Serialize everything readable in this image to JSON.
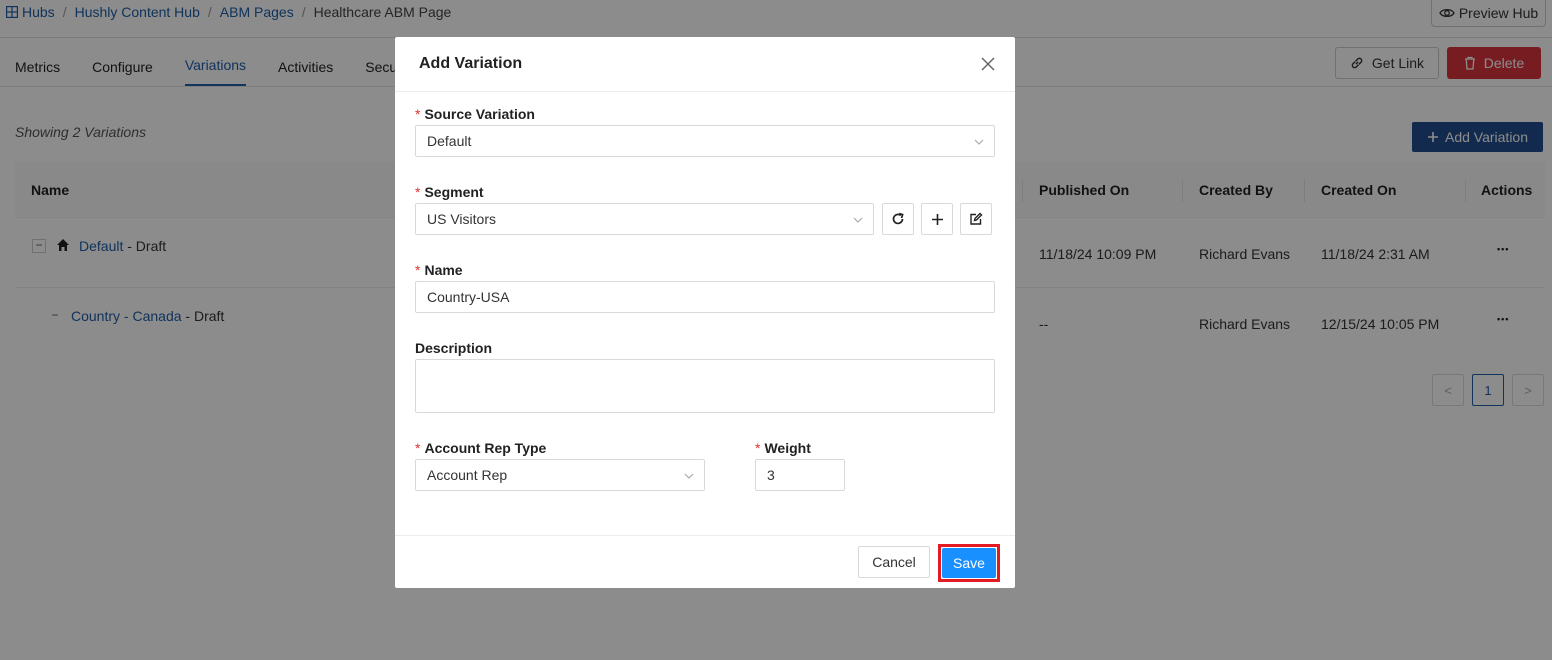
{
  "breadcrumb": {
    "items": [
      "Hubs",
      "Hushly Content Hub",
      "ABM Pages",
      "Healthcare ABM Page"
    ],
    "separator": "/"
  },
  "header": {
    "preview_label": "Preview Hub",
    "get_link_label": "Get Link",
    "delete_label": "Delete"
  },
  "tabs": [
    {
      "label": "Metrics"
    },
    {
      "label": "Configure"
    },
    {
      "label": "Variations",
      "active": true
    },
    {
      "label": "Activities"
    },
    {
      "label": "Securit"
    }
  ],
  "main": {
    "showing_text": "Showing 2 Variations",
    "add_variation_label": "Add Variation"
  },
  "table": {
    "columns": [
      "Name",
      "Published On",
      "Created By",
      "Created On",
      "Actions"
    ],
    "rows": [
      {
        "expander": "−",
        "name_link": "Default",
        "name_suffix": " - Draft",
        "published_on": "11/18/24 10:09 PM",
        "created_by": "Richard Evans",
        "created_on": "11/18/24 2:31 AM",
        "actions": "•••"
      },
      {
        "expander": "−",
        "name_link_1": "Country",
        "name_sep": " - ",
        "name_link_2": "Canada",
        "name_suffix": " - Draft",
        "published_on": "--",
        "created_by": "Richard Evans",
        "created_on": "12/15/24 10:05 PM",
        "actions": "•••"
      }
    ]
  },
  "pagination": {
    "prev": "<",
    "current": "1",
    "next": ">"
  },
  "modal": {
    "title": "Add Variation",
    "required_mark": "*",
    "source_variation": {
      "label": "Source Variation",
      "value": "Default"
    },
    "segment": {
      "label": "Segment",
      "value": "US Visitors"
    },
    "name": {
      "label": "Name",
      "value": "Country-USA"
    },
    "description": {
      "label": "Description",
      "value": ""
    },
    "account_rep_type": {
      "label": "Account Rep Type",
      "value": "Account Rep"
    },
    "weight": {
      "label": "Weight",
      "value": "3"
    },
    "cancel_label": "Cancel",
    "save_label": "Save"
  },
  "colors": {
    "link": "#1f5ea8",
    "primary": "#1890ff",
    "danger": "#d9363e",
    "highlight": "#e31b23"
  },
  "icons": [
    "grid-icon",
    "eye-icon",
    "link-icon",
    "trash-icon",
    "plus-icon",
    "home-icon",
    "close-icon",
    "chevron-down-icon",
    "refresh-icon",
    "edit-icon"
  ]
}
